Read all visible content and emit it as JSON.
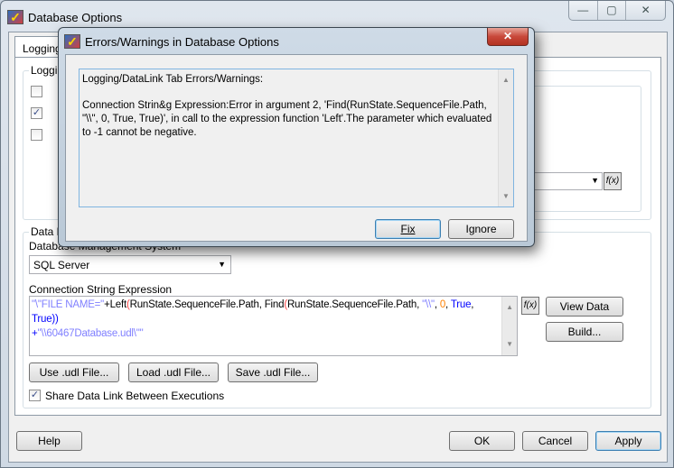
{
  "main_window": {
    "title": "Database Options",
    "window_controls": {
      "minimize": "—",
      "maximize": "▢",
      "close": "✕"
    },
    "tab_label": "Logging/DataLink",
    "logging_group_label": "Logging",
    "checkboxes": [
      {
        "checked": false
      },
      {
        "checked": true
      },
      {
        "checked": false
      }
    ],
    "data_link_group_label": "Data Link",
    "db_mgmt_label": "Database Management System",
    "db_mgmt_value": "SQL Server",
    "conn_label": "Connection String Expression",
    "conn_expr": {
      "t1": "\"\\\"FILE NAME=\"",
      "t2": "+Left",
      "t3": "(",
      "t4": "RunState.SequenceFile.Path, Find",
      "t5": "(",
      "t6": "RunState.SequenceFile.Path, ",
      "t7": "\"\\\\\"",
      "t8": ", ",
      "t9": "0",
      "t10": ", ",
      "t11": "True",
      "t12": ", ",
      "t13": "True",
      "t14": "))",
      "t15": "+",
      "t16": "\"\\\\60467Database.udl\\\"\""
    },
    "fx_label": "f(x)",
    "view_data": "View Data",
    "build": "Build...",
    "use_udl": "Use .udl File...",
    "load_udl": "Load .udl File...",
    "save_udl": "Save .udl File...",
    "share_label": "Share Data Link Between Executions",
    "share_checked": true,
    "help": "Help",
    "ok": "OK",
    "cancel": "Cancel",
    "apply": "Apply"
  },
  "error_dialog": {
    "title": "Errors/Warnings in Database Options",
    "close": "✕",
    "heading": "Logging/DataLink Tab Errors/Warnings:",
    "message": "Connection Strin&g Expression:Error in argument 2, 'Find(RunState.SequenceFile.Path, \"\\\\\", 0, True, True)', in call to the expression function 'Left'.The parameter which evaluated to -1 cannot be negative.",
    "fix": "Fix",
    "ignore": "Ignore"
  },
  "colors": {
    "string": "#8080ff",
    "paren": "#ff4040",
    "number": "#ff8000",
    "keyword": "#0000ff",
    "close_btn": "#c8483a"
  }
}
